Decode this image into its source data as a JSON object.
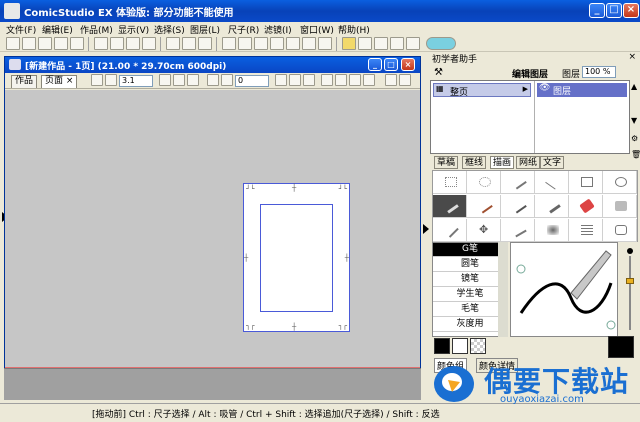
{
  "window": {
    "title": "ComicStudio EX 体验版: 部分功能不能使用",
    "min_label": "_",
    "max_label": "□",
    "close_label": "×"
  },
  "menu": [
    "文件(F)",
    "编辑(E)",
    "作品(M)",
    "显示(V)",
    "选择(S)",
    "图层(L)",
    "尺子(R)",
    "滤镜(I)",
    "窗口(W)",
    "帮助(H)"
  ],
  "document": {
    "title": "[新建作品 - 1页] (21.00 * 29.70cm 600dpi)",
    "tabs": [
      "作品",
      "页面 ×"
    ],
    "zoom_value": "3.1",
    "rotate_value": "0"
  },
  "helper": {
    "title": "初学者助手",
    "edit_layer_label": "编辑图层",
    "layer_label": "图层",
    "zoom": "100 %",
    "page_item": "整页",
    "layer_item": "图层"
  },
  "tool_tabs": [
    "草稿",
    "框线",
    "描画",
    "网纸",
    "文字"
  ],
  "active_tool_tab": "描画",
  "brushes": [
    "G笔",
    "圆笔",
    "镜笔",
    "学生笔",
    "毛笔",
    "灰度用"
  ],
  "selected_brush": "G笔",
  "colors": {
    "accent": "#0a5fe0",
    "selected_layer": "#6570c8",
    "page_highlight": "#c5cbe8",
    "main_color": "#000000",
    "sub_color": "#ffffff"
  },
  "color_tabs": [
    "颜色组",
    "颜色详情"
  ],
  "status": "[拖动前] Ctrl : 尺子选择 / Alt : 吸管 / Ctrl + Shift : 选择追加(尺子选择) / Shift : 反选",
  "watermark": {
    "text": "偶要下载站",
    "url": "ouyaoxiazai.com"
  }
}
